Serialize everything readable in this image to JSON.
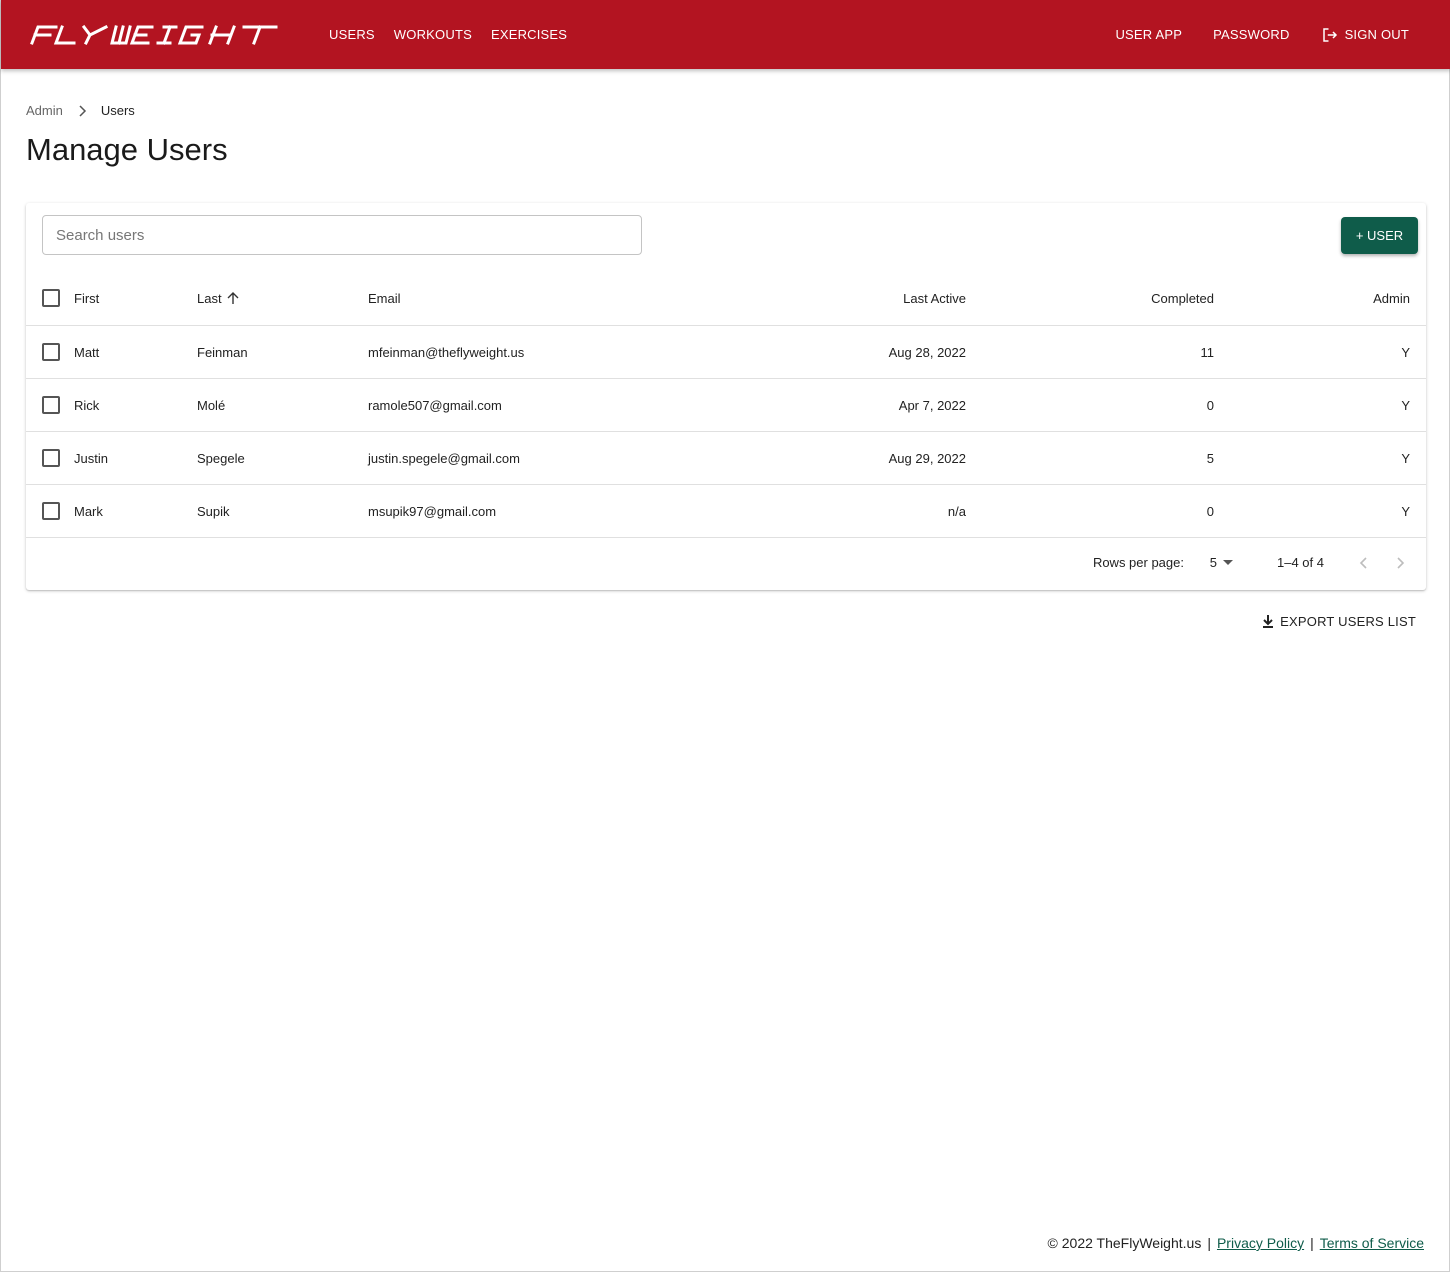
{
  "brand": {
    "logo_text": "FLYWEIGHT",
    "primary": "#b31421",
    "accent": "#0f5c4a"
  },
  "nav": {
    "left": [
      "USERS",
      "WORKOUTS",
      "EXERCISES"
    ],
    "right": {
      "user_app": "USER APP",
      "password": "PASSWORD",
      "sign_out": "SIGN OUT"
    }
  },
  "breadcrumb": {
    "parent": "Admin",
    "current": "Users"
  },
  "page_title": "Manage Users",
  "search": {
    "placeholder": "Search users",
    "value": ""
  },
  "add_user_label": "+ USER",
  "table": {
    "headers": {
      "first": "First",
      "last": "Last",
      "email": "Email",
      "last_active": "Last Active",
      "completed": "Completed",
      "admin": "Admin"
    },
    "sort": {
      "column": "Last",
      "direction": "ascending"
    },
    "rows": [
      {
        "first": "Matt",
        "last": "Feinman",
        "email": "mfeinman@theflyweight.us",
        "last_active": "Aug 28, 2022",
        "completed": "11",
        "admin": "Y"
      },
      {
        "first": "Rick",
        "last": "Molé",
        "email": "ramole507@gmail.com",
        "last_active": "Apr 7, 2022",
        "completed": "0",
        "admin": "Y"
      },
      {
        "first": "Justin",
        "last": "Spegele",
        "email": "justin.spegele@gmail.com",
        "last_active": "Aug 29, 2022",
        "completed": "5",
        "admin": "Y"
      },
      {
        "first": "Mark",
        "last": "Supik",
        "email": "msupik97@gmail.com",
        "last_active": "n/a",
        "completed": "0",
        "admin": "Y"
      }
    ]
  },
  "pagination": {
    "rows_per_page_label": "Rows per page:",
    "rows_per_page": "5",
    "range": "1–4 of 4"
  },
  "export_label": "EXPORT USERS LIST",
  "footer": {
    "copyright": "© 2022 TheFlyWeight.us",
    "privacy": "Privacy Policy",
    "terms": "Terms of Service",
    "separator": "|"
  },
  "icons": [
    "logo",
    "sign-out-icon",
    "chevron-right-icon",
    "arrow-up-icon",
    "caret-down-icon",
    "chevron-left-icon",
    "download-icon"
  ]
}
